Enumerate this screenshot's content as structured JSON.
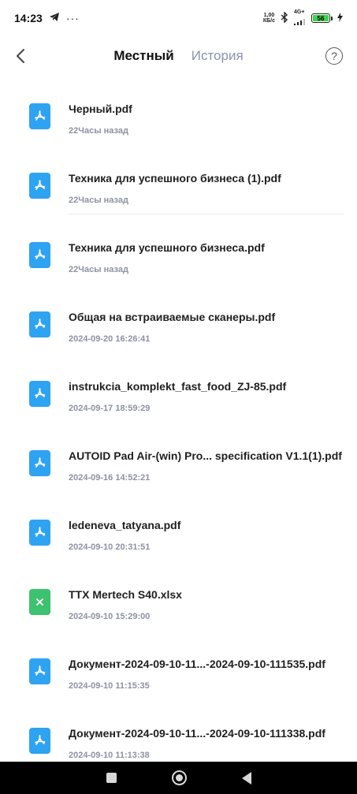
{
  "status_bar": {
    "time": "14:23",
    "net_speed_value": "1,00",
    "net_speed_unit": "КБ/с",
    "network_type": "4G+",
    "battery_level": "56"
  },
  "header": {
    "tabs": [
      {
        "label": "Местный",
        "active": true
      },
      {
        "label": "История",
        "active": false
      }
    ],
    "help_label": "?"
  },
  "files": [
    {
      "name": "Черный.pdf",
      "date": "22Часы назад",
      "type": "pdf"
    },
    {
      "name": "Техника для успешного бизнеса (1).pdf",
      "date": "22Часы назад",
      "type": "pdf"
    },
    {
      "name": "Техника для успешного бизнеса.pdf",
      "date": "22Часы назад",
      "type": "pdf"
    },
    {
      "name": "Общая на встраиваемые сканеры.pdf",
      "date": "2024-09-20 16:26:41",
      "type": "pdf"
    },
    {
      "name": "instrukcia_komplekt_fast_food_ZJ-85.pdf",
      "date": "2024-09-17 18:59:29",
      "type": "pdf"
    },
    {
      "name": "AUTOID Pad Air-(win) Pro... specification V1.1(1).pdf",
      "date": "2024-09-16 14:52:21",
      "type": "pdf"
    },
    {
      "name": "ledeneva_tatyana.pdf",
      "date": "2024-09-10 20:31:51",
      "type": "pdf"
    },
    {
      "name": "TTX Mertech S40.xlsx",
      "date": "2024-09-10 15:29:00",
      "type": "xlsx"
    },
    {
      "name": "Документ-2024-09-10-11...-2024-09-10-111535.pdf",
      "date": "2024-09-10 11:15:35",
      "type": "pdf"
    },
    {
      "name": "Документ-2024-09-10-11...-2024-09-10-111338.pdf",
      "date": "2024-09-10 11:13:38",
      "type": "pdf"
    }
  ],
  "colors": {
    "pdf_icon": "#2ea3f2",
    "xlsx_icon": "#3dc26f",
    "date_text": "#8b93a1",
    "inactive_tab": "#8a94a6"
  }
}
